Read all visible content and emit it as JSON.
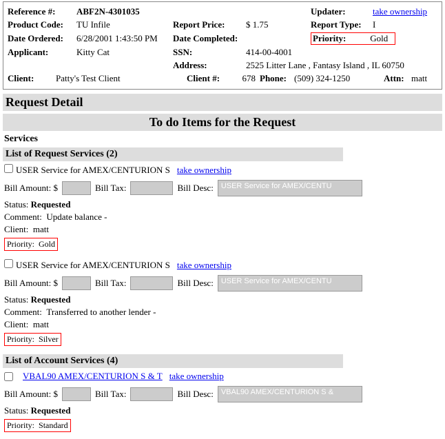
{
  "header": {
    "reference_lbl": "Reference #:",
    "reference_val": "ABF2N-4301035",
    "updater_lbl": "Updater:",
    "updater_link": "take ownership",
    "product_lbl": "Product Code:",
    "product_val": "TU Infile",
    "report_price_lbl": "Report Price:",
    "report_price_val": "$ 1.75",
    "report_type_lbl": "Report Type:",
    "report_type_val": "I",
    "date_ordered_lbl": "Date Ordered:",
    "date_ordered_val": "6/28/2001 1:43:50 PM",
    "date_completed_lbl": "Date Completed:",
    "priority_lbl": "Priority:",
    "priority_val": "Gold",
    "applicant_lbl": "Applicant:",
    "applicant_val": "Kitty Cat",
    "ssn_lbl": "SSN:",
    "ssn_val": "414-00-4001",
    "address_lbl": "Address:",
    "address_val": "2525 Litter Lane , Fantasy Island , IL  60750",
    "client_lbl": "Client:",
    "client_val": "Patty's Test Client",
    "clientnum_lbl": "Client #:",
    "clientnum_val": "678",
    "phone_lbl": "Phone:",
    "phone_val": "(509) 324-1250",
    "attn_lbl": "Attn:",
    "attn_val": "matt"
  },
  "sections": {
    "request_detail": "Request Detail",
    "todo": "To do Items for the Request",
    "services": "Services",
    "req_services": "List of Request Services (2)",
    "acct_services": "List of Account Services (4)"
  },
  "labels": {
    "bill_amount": "Bill Amount: $",
    "bill_tax": "Bill Tax:",
    "bill_desc": "Bill Desc:",
    "status": "Status:",
    "comment": "Comment:",
    "client": "Client:",
    "priority": "Priority:",
    "take_ownership": "take ownership"
  },
  "svc1": {
    "title": "USER Service for AMEX/CENTURION S",
    "desc": "USER Service for AMEX/CENTU",
    "status": "Requested",
    "comment": "Update balance -",
    "client": "matt",
    "priority": "Gold"
  },
  "svc2": {
    "title": "USER Service for AMEX/CENTURION S",
    "desc": "USER Service for AMEX/CENTU",
    "status": "Requested",
    "comment": "Transferred to another lender -",
    "client": "matt",
    "priority": "Silver"
  },
  "svc3": {
    "title": "VBAL90 AMEX/CENTURION S & T",
    "desc": "VBAL90 AMEX/CENTURION S &",
    "status": "Requested",
    "priority": "Standard"
  }
}
